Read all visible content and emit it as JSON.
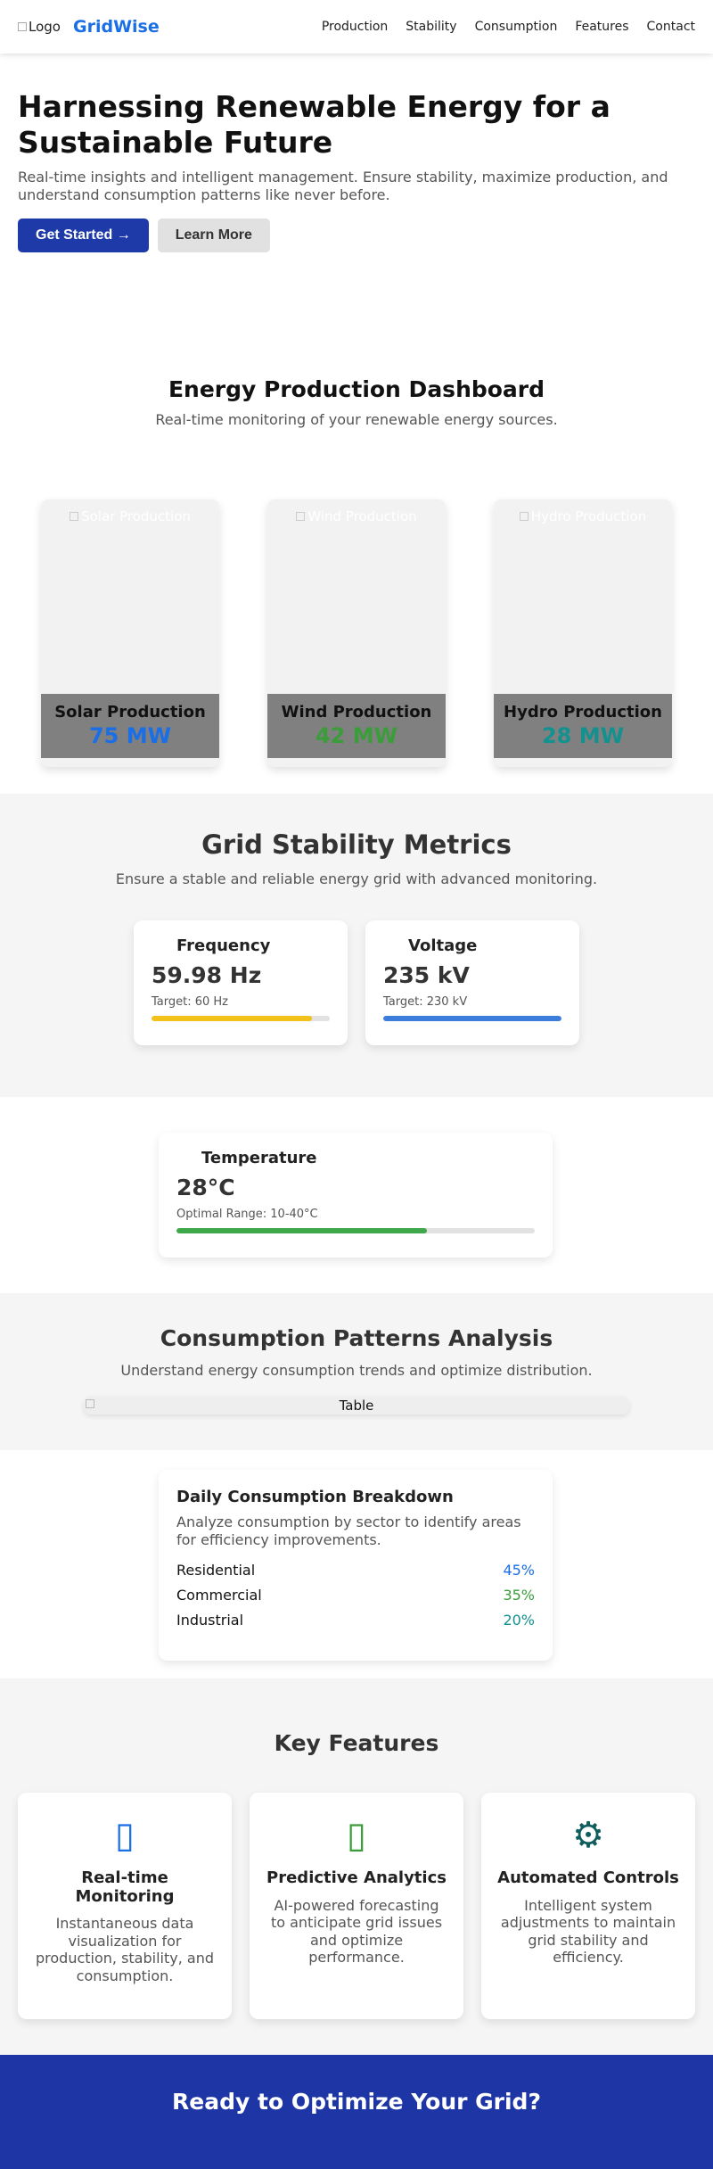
{
  "nav": {
    "logo_alt": "Logo",
    "brand": "GridWise",
    "links": [
      "Production",
      "Stability",
      "Consumption",
      "Features",
      "Contact"
    ]
  },
  "hero": {
    "title": "Harnessing Renewable Energy for a Sustainable Future",
    "subtitle": "Real-time insights and intelligent management. Ensure stability, maximize production, and understand consumption patterns like never before.",
    "primary_button": "Get Started →",
    "secondary_button": "Learn More"
  },
  "dashboard": {
    "title": "Energy Production Dashboard",
    "subtitle": "Real-time monitoring of your renewable energy sources.",
    "cards": [
      {
        "img_alt": "Solar Production",
        "label": "Solar Production",
        "value": "75 MW",
        "color": "#1a6ee6"
      },
      {
        "img_alt": "Wind Production",
        "label": "Wind Production",
        "value": "42 MW",
        "color": "#3a9d3a"
      },
      {
        "img_alt": "Hydro Production",
        "label": "Hydro Production",
        "value": "28 MW",
        "color": "#13918f"
      }
    ]
  },
  "stability": {
    "title": "Grid Stability Metrics",
    "subtitle": "Ensure a stable and reliable energy grid with advanced monitoring.",
    "metrics": [
      {
        "title": "Frequency",
        "value": "59.98 Hz",
        "target": "Target: 60 Hz",
        "progress": 0.9,
        "color": "#f2c21b"
      },
      {
        "title": "Voltage",
        "value": "235 kV",
        "target": "Target: 230 kV",
        "progress": 1.0,
        "color": "#3c7ddc"
      },
      {
        "title": "Temperature",
        "value": "28°C",
        "target": "Optimal Range: 10-40°C",
        "progress": 0.7,
        "color": "#3ea84a"
      }
    ]
  },
  "consumption": {
    "title": "Consumption Patterns Analysis",
    "subtitle": "Understand energy consumption trends and optimize distribution.",
    "table_alt": "Table",
    "breakdown": {
      "title": "Daily Consumption Breakdown",
      "description": "Analyze consumption by sector to identify areas for efficiency improvements.",
      "rows": [
        {
          "sector": "Residential",
          "pct": "45%",
          "color": "#1a6ee6"
        },
        {
          "sector": "Commercial",
          "pct": "35%",
          "color": "#3a9d3a"
        },
        {
          "sector": "Industrial",
          "pct": "20%",
          "color": "#13918f"
        }
      ]
    }
  },
  "features": {
    "title": "Key Features",
    "items": [
      {
        "icon": "monitor-icon",
        "glyph": "▯",
        "color": "#1a6ee6",
        "title": "Real-time Monitoring",
        "text": "Instantaneous data visualization for production, stability, and consumption."
      },
      {
        "icon": "analytics-icon",
        "glyph": "▯",
        "color": "#3a9d3a",
        "title": "Predictive Analytics",
        "text": "AI-powered forecasting to anticipate grid issues and optimize performance."
      },
      {
        "icon": "gear-icon",
        "glyph": "⚙",
        "color": "#0f5d5d",
        "title": "Automated Controls",
        "text": "Intelligent system adjustments to maintain grid stability and efficiency."
      }
    ]
  },
  "cta": {
    "title": "Ready to Optimize Your Grid?"
  }
}
